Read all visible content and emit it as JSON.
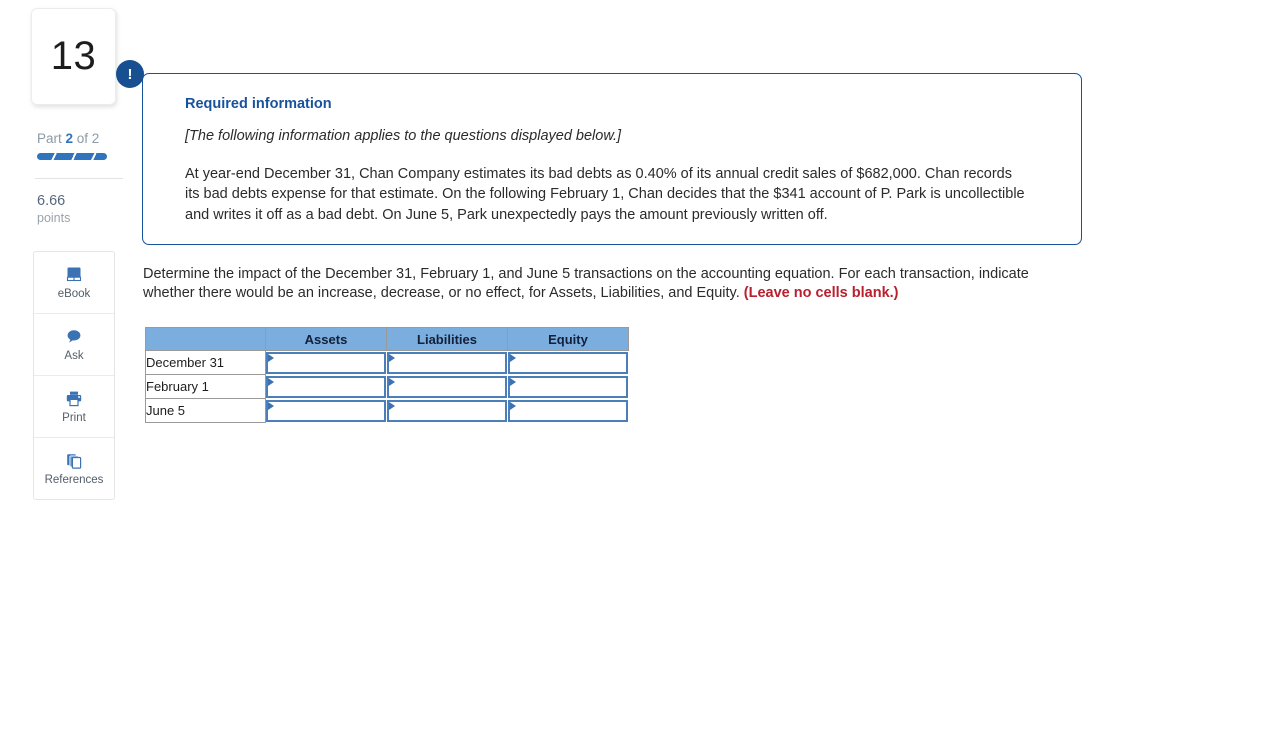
{
  "sidebar": {
    "question_number": "13",
    "part_prefix": "Part ",
    "part_current": "2",
    "part_suffix": " of 2",
    "points_value": "6.66",
    "points_label": "points",
    "tools": [
      {
        "label": "eBook",
        "icon": "book-icon"
      },
      {
        "label": "Ask",
        "icon": "chat-bubble-icon"
      },
      {
        "label": "Print",
        "icon": "printer-icon"
      },
      {
        "label": "References",
        "icon": "copy-pages-icon"
      }
    ]
  },
  "required_box": {
    "badge": "!",
    "title": "Required information",
    "italic_note": "[The following information applies to the questions displayed below.]",
    "body": "At year-end December 31, Chan Company estimates its bad debts as 0.40% of its annual credit sales of $682,000. Chan records its bad debts expense for that estimate. On the following February 1, Chan decides that the $341 account of P. Park is uncollectible and writes it off as a bad debt. On June 5, Park unexpectedly pays the amount previously written off."
  },
  "prompt": {
    "text": "Determine the impact of the December 31, February 1, and June 5 transactions on the accounting equation. For each transaction, indicate whether there would be an increase, decrease, or no effect, for Assets, Liabilities, and Equity. ",
    "warning": "(Leave no cells blank.)"
  },
  "table": {
    "corner_header": "",
    "columns": [
      "Assets",
      "Liabilities",
      "Equity"
    ],
    "rows": [
      {
        "label": "December 31",
        "cells": [
          "",
          "",
          ""
        ]
      },
      {
        "label": "February 1",
        "cells": [
          "",
          "",
          ""
        ]
      },
      {
        "label": "June 5",
        "cells": [
          "",
          "",
          ""
        ]
      }
    ]
  },
  "colors": {
    "accent_blue": "#2f74bd",
    "header_blue": "#7badde",
    "box_border": "#17529b",
    "badge_navy": "#184f91",
    "warning_red": "#b8202e",
    "cell_border_blue": "#4a7fba"
  }
}
